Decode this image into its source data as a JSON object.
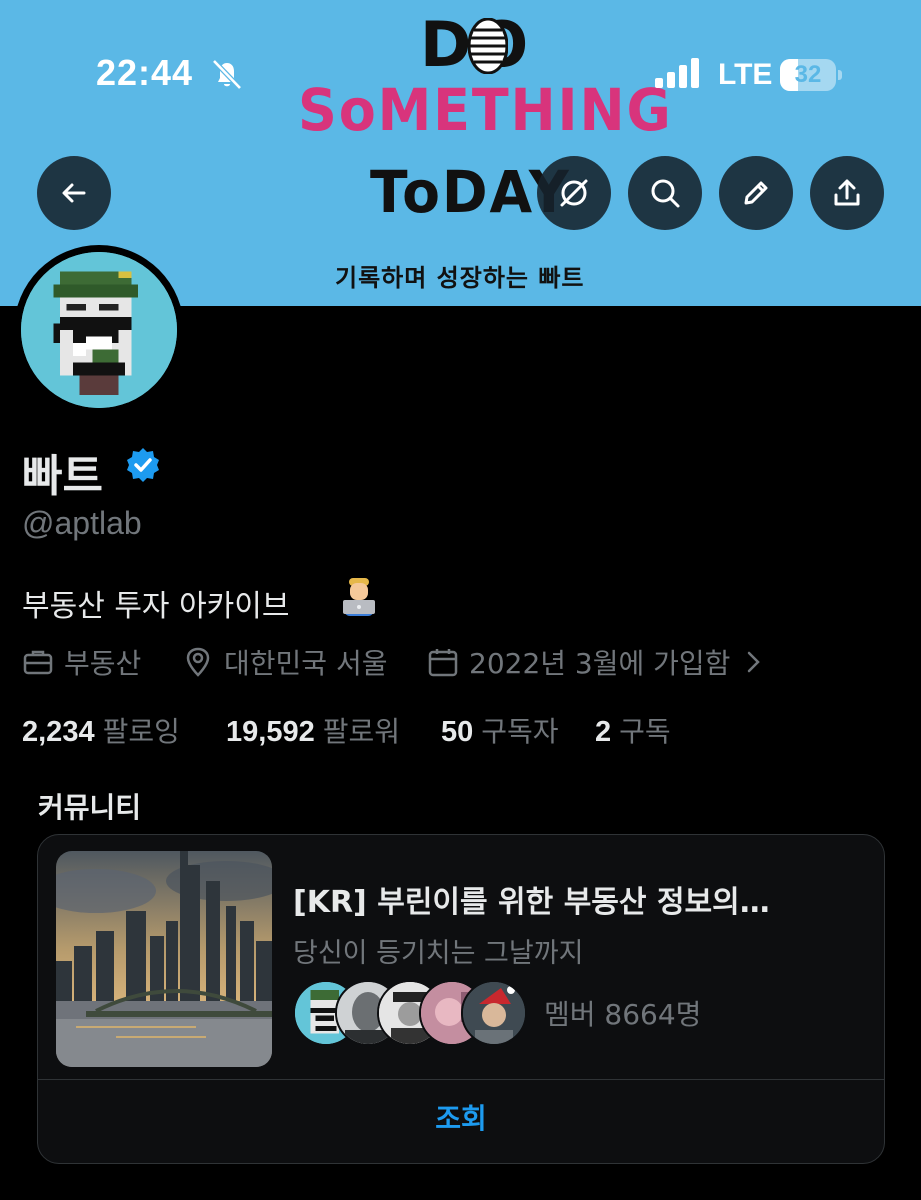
{
  "status_bar": {
    "time": "22:44",
    "network": "LTE",
    "battery": "32",
    "battery_level": 0.32
  },
  "banner": {
    "line1": "DO",
    "line2": "SoMETHING",
    "line3": "ToDAY",
    "tagline": "기록하며 성장하는 빠트",
    "colors": {
      "background": "#5bb8e6",
      "accent": "#d8347c"
    }
  },
  "nav": {
    "icons": [
      "back-arrow-icon",
      "grok-icon",
      "search-icon",
      "edit-icon",
      "share-icon"
    ]
  },
  "profile": {
    "name": "빠트",
    "handle": "@aptlab",
    "bio": "부동산 투자 아카이브",
    "category": "부동산",
    "location": "대한민국 서울",
    "joined": "2022년 3월에 가입함",
    "verified": true
  },
  "stats": {
    "following_count": "2,234",
    "following_label": "팔로잉",
    "followers_count": "19,592",
    "followers_label": "팔로워",
    "subscribers_count": "50",
    "subscribers_label": "구독자",
    "subscriptions_count": "2",
    "subscriptions_label": "구독"
  },
  "community": {
    "section_title": "커뮤니티",
    "title": "[KR] 부린이를 위한 부동산 정보의…",
    "subtitle": "당신이 등기치는 그날까지",
    "members": "멤버 8664명",
    "view_button": "조회"
  }
}
